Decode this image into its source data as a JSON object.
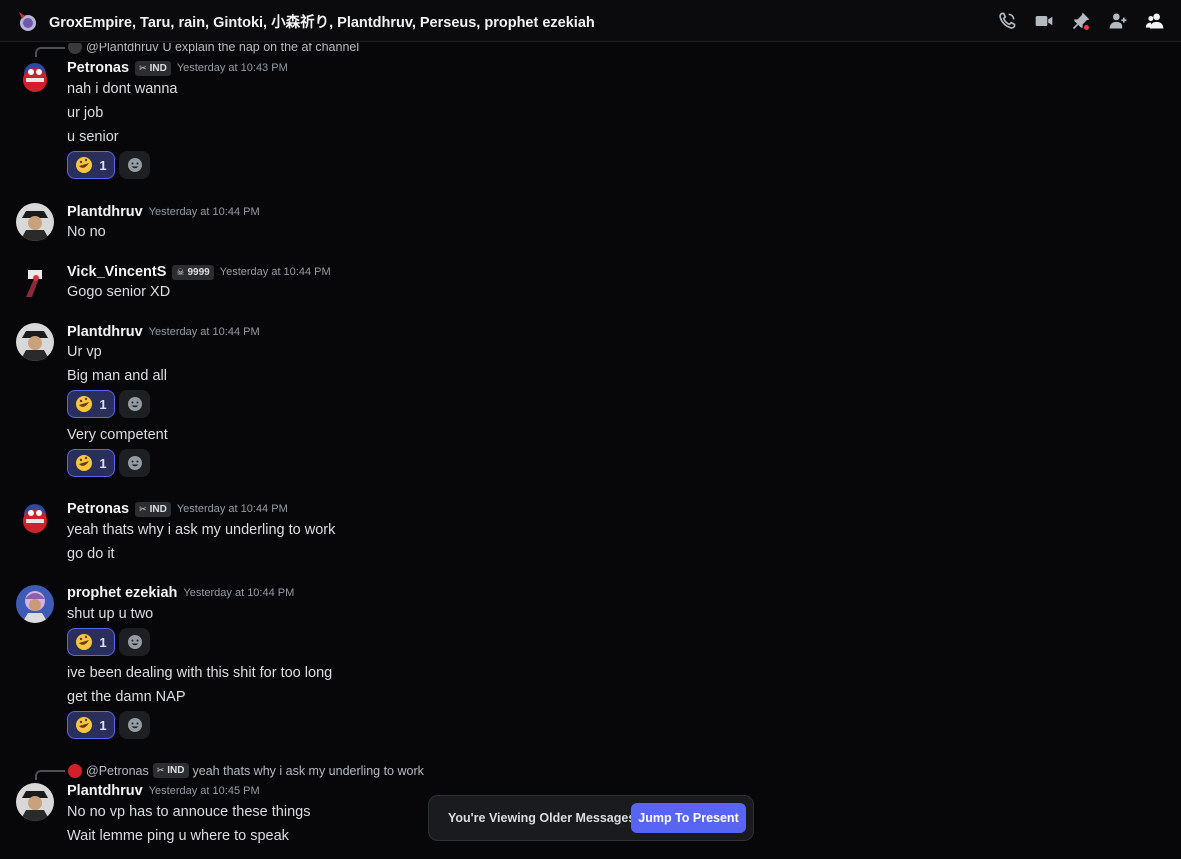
{
  "header": {
    "title": "GroxEmpire, Taru, rain, Gintoki, 小森祈り, Plantdhruv, Perseus, prophet ezekiah",
    "actions": [
      "voice-call-icon",
      "video-call-icon",
      "pinned-messages-icon",
      "add-friends-icon",
      "member-list-icon"
    ]
  },
  "colors": {
    "accent": "#5865f2",
    "background": "#070709",
    "text": "#dbdee1",
    "muted": "#949ba4"
  },
  "messages": [
    {
      "reply": {
        "mention": "@Plantdhruv",
        "text": "U explain the nap on the af channel"
      },
      "author": "Petronas",
      "tag": "IND",
      "timestamp": "Yesterday at 10:43 PM",
      "lines": [
        "nah i dont wanna",
        "ur job",
        "u senior"
      ],
      "reaction": {
        "emoji": "rofl",
        "count": "1"
      }
    },
    {
      "author": "Plantdhruv",
      "timestamp": "Yesterday at 10:44 PM",
      "lines": [
        "No no"
      ]
    },
    {
      "author": "Vick_VincentS",
      "tag": "9999",
      "timestamp": "Yesterday at 10:44 PM",
      "lines": [
        "Gogo senior XD"
      ]
    },
    {
      "author": "Plantdhruv",
      "timestamp": "Yesterday at 10:44 PM",
      "lines": [
        "Ur vp",
        "Big man and all",
        "Very competent"
      ],
      "reactions": [
        {
          "emoji": "rofl",
          "count": "1"
        },
        {
          "emoji": "rofl",
          "count": "1"
        }
      ]
    },
    {
      "author": "Petronas",
      "tag": "IND",
      "timestamp": "Yesterday at 10:44 PM",
      "lines": [
        "yeah  thats why i ask my underling to work",
        "go do it"
      ]
    },
    {
      "author": "prophet ezekiah",
      "timestamp": "Yesterday at 10:44 PM",
      "lines": [
        "shut up u two",
        "ive been dealing with this shit for too long",
        "get the damn NAP"
      ],
      "reactions": [
        {
          "emoji": "rofl",
          "count": "1"
        },
        {
          "emoji": "rofl",
          "count": "1"
        }
      ]
    },
    {
      "reply": {
        "mention": "@Petronas",
        "tag": "IND",
        "text": "yeah  thats why i ask my underling to work"
      },
      "author": "Plantdhruv",
      "timestamp": "Yesterday at 10:45 PM",
      "lines": [
        "No no vp has to annouce these things",
        "Wait lemme ping u where to speak"
      ]
    }
  ],
  "jump_bar": {
    "text": "You're Viewing Older Messages",
    "button": "Jump To Present"
  }
}
